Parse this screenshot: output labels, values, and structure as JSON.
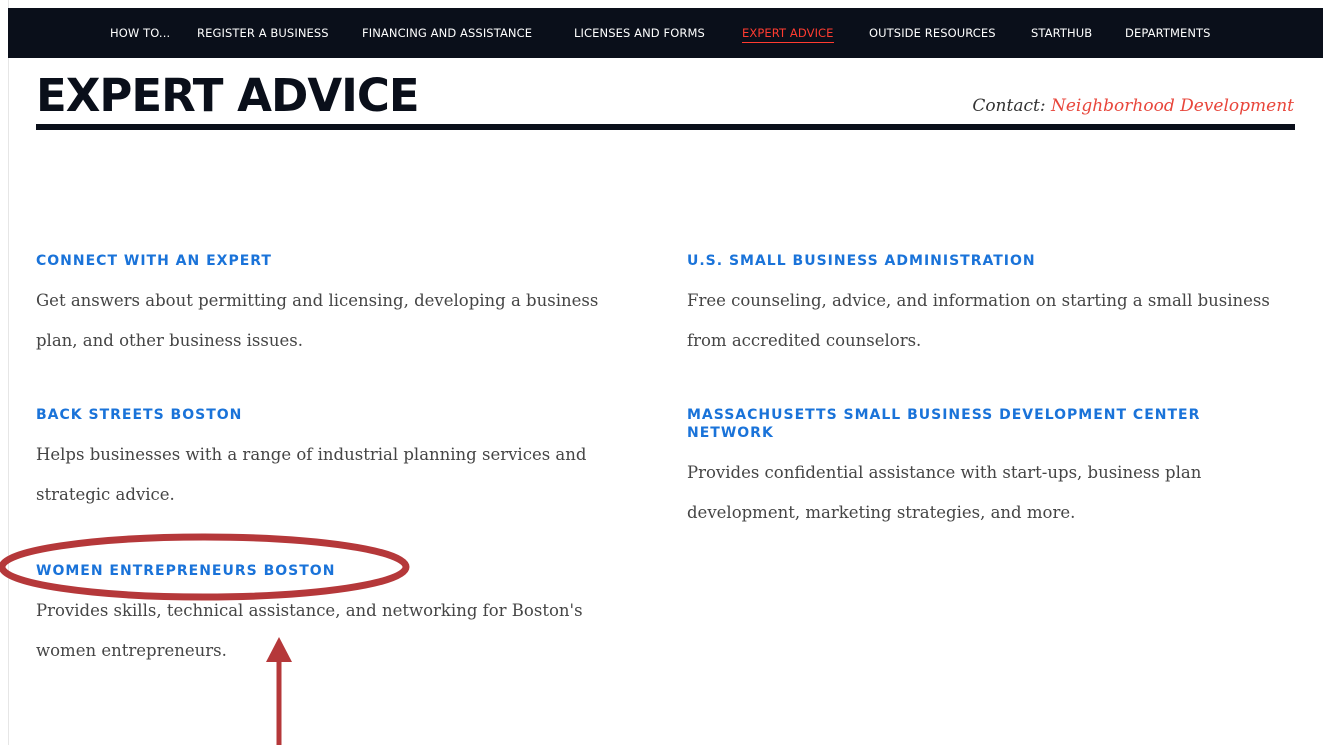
{
  "nav": {
    "items": [
      {
        "label": "HOW TO..."
      },
      {
        "label": "REGISTER A BUSINESS"
      },
      {
        "label": "FINANCING AND ASSISTANCE"
      },
      {
        "label": "LICENSES AND FORMS"
      },
      {
        "label": "EXPERT ADVICE",
        "active": true
      },
      {
        "label": "OUTSIDE RESOURCES"
      },
      {
        "label": "STARTHUB"
      },
      {
        "label": "DEPARTMENTS"
      }
    ]
  },
  "header": {
    "title": "EXPERT ADVICE",
    "contact_label": "Contact:",
    "contact_link": "Neighborhood Development"
  },
  "cards": [
    {
      "title": "CONNECT WITH AN EXPERT",
      "description": "Get answers about permitting and licensing, developing a business plan, and other business issues."
    },
    {
      "title": "BACK STREETS BOSTON",
      "description": "Helps businesses with a range of industrial planning services and strategic advice."
    },
    {
      "title": "WOMEN ENTREPRENEURS BOSTON",
      "description": "Provides skills, technical assistance, and networking for Boston's women entrepreneurs."
    },
    {
      "title": "U.S. SMALL BUSINESS ADMINISTRATION",
      "description": "Free counseling, advice, and information on starting a small business from accredited counselors."
    },
    {
      "title": "MASSACHUSETTS SMALL BUSINESS DEVELOPMENT CENTER NETWORK",
      "description": "Provides confidential assistance with start-ups, business plan development, marketing strategies, and more."
    }
  ],
  "colors": {
    "nav_background": "#0a0f1a",
    "active_nav": "#ff3b30",
    "link_blue": "#1a73d9",
    "contact_link": "#e8463b",
    "annotation": "#b5383a"
  }
}
